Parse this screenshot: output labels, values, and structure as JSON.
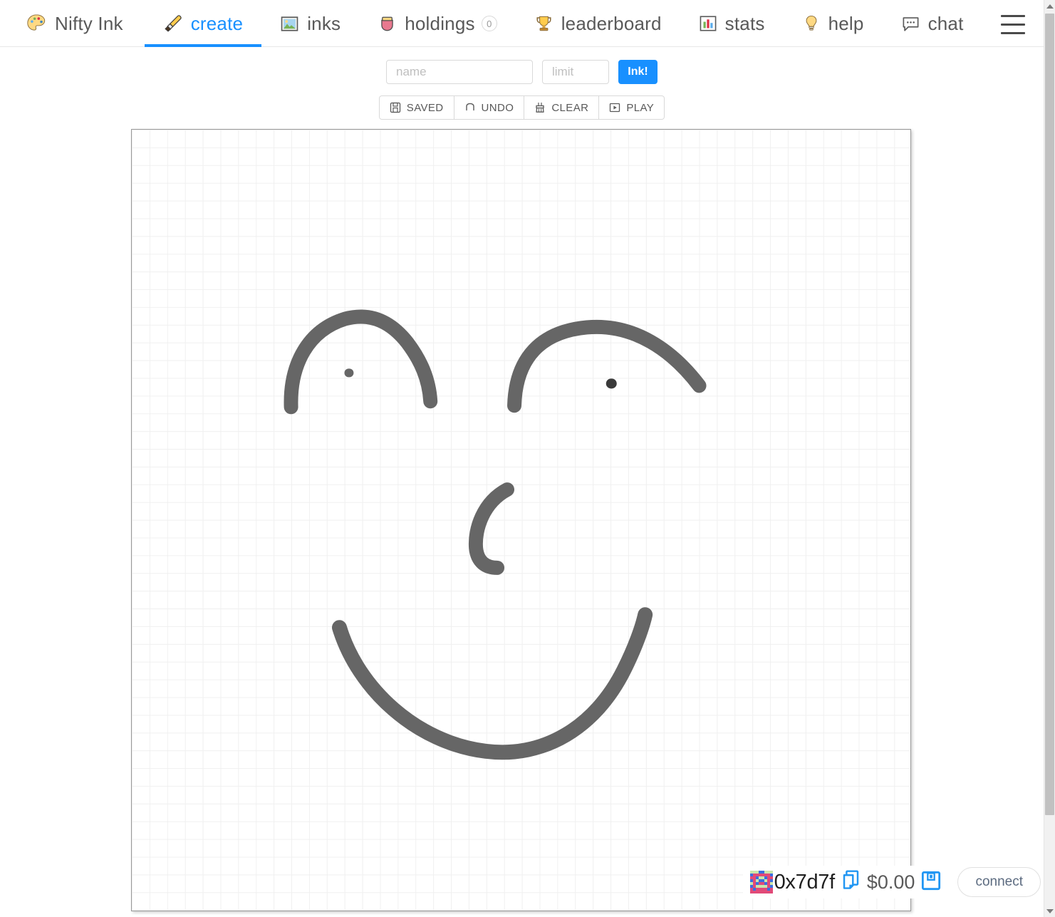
{
  "app": {
    "brand": "Nifty Ink",
    "brand_icon": "palette-icon"
  },
  "nav": {
    "items": [
      {
        "label": "create",
        "icon": "paintbrush-icon",
        "active": true,
        "badge": null
      },
      {
        "label": "inks",
        "icon": "framed-picture-icon",
        "active": false,
        "badge": null
      },
      {
        "label": "holdings",
        "icon": "coin-purse-icon",
        "active": false,
        "badge": "0"
      },
      {
        "label": "leaderboard",
        "icon": "trophy-icon",
        "active": false,
        "badge": null
      },
      {
        "label": "stats",
        "icon": "bar-chart-icon",
        "active": false,
        "badge": null
      },
      {
        "label": "help",
        "icon": "light-bulb-icon",
        "active": false,
        "badge": null
      },
      {
        "label": "chat",
        "icon": "speech-balloon-icon",
        "active": false,
        "badge": null
      }
    ],
    "menu_icon": "hamburger-menu-icon"
  },
  "ink_form": {
    "name_placeholder": "name",
    "name_value": "",
    "limit_placeholder": "limit",
    "limit_value": "",
    "ink_button_label": "Ink!",
    "ink_button_color": "#1890ff"
  },
  "actions": [
    {
      "label": "SAVED",
      "icon": "save-icon"
    },
    {
      "label": "UNDO",
      "icon": "undo-icon"
    },
    {
      "label": "CLEAR",
      "icon": "broom-icon"
    },
    {
      "label": "PLAY",
      "icon": "play-icon"
    }
  ],
  "canvas": {
    "grid_color": "#f0f0f0",
    "grid_size_px": 25,
    "background": "#ffffff",
    "stroke_color": "#666666",
    "drawing_description": "hand-drawn smiley face with two eyebrow arcs, two eye dots, a curved nose and a wide smiling mouth"
  },
  "account": {
    "address": "0x7d7f",
    "balance": "$0.00",
    "copy_icon": "copy-icon",
    "save_icon": "floppy-disk-icon",
    "avatar": "blockie-avatar",
    "connect_label": "connect",
    "accent_color": "#2196f3"
  },
  "scrollbar": {
    "up_icon": "arrow-up-icon",
    "down_icon": "arrow-down-icon"
  }
}
